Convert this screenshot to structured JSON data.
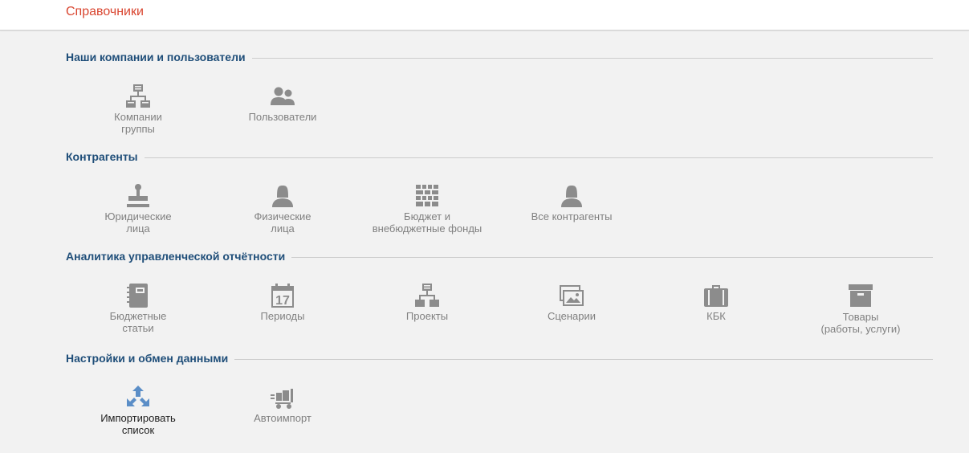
{
  "header": {
    "title": "Справочники"
  },
  "colors": {
    "title": "#d9452f",
    "section": "#1f4e79",
    "icon": "#8c8c8c",
    "icon_accent": "#5b8ec7",
    "label": "#808080"
  },
  "sections": [
    {
      "title": "Наши компании и пользователи",
      "items": [
        {
          "label": "Компании\nгруппы",
          "icon": "org-structure-icon"
        },
        {
          "label": "Пользователи",
          "icon": "users-icon"
        }
      ]
    },
    {
      "title": "Контрагенты",
      "items": [
        {
          "label": "Юридические\nлица",
          "icon": "stamp-icon"
        },
        {
          "label": "Физические\nлица",
          "icon": "person-female-icon"
        },
        {
          "label": "Бюджет и\nвнебюджетные фонды",
          "icon": "castle-icon"
        },
        {
          "label": "Все контрагенты",
          "icon": "person-all-icon"
        }
      ]
    },
    {
      "title": "Аналитика управленческой отчётности",
      "items": [
        {
          "label": "Бюджетные\nстатьи",
          "icon": "notebook-icon"
        },
        {
          "label": "Периоды",
          "icon": "calendar-icon",
          "calendar_day": "17"
        },
        {
          "label": "Проекты",
          "icon": "project-structure-icon"
        },
        {
          "label": "Сценарии",
          "icon": "pictures-icon"
        },
        {
          "label": "КБК",
          "icon": "briefcase-icon"
        },
        {
          "label": "Товары\n(работы, услуги)",
          "icon": "archive-box-icon"
        }
      ]
    },
    {
      "title": "Настройки и обмен данными",
      "items": [
        {
          "label": "Импортировать\nсписок",
          "icon": "import-arrows-icon"
        },
        {
          "label": "Автоимпорт",
          "icon": "delivery-cart-icon"
        }
      ]
    }
  ]
}
